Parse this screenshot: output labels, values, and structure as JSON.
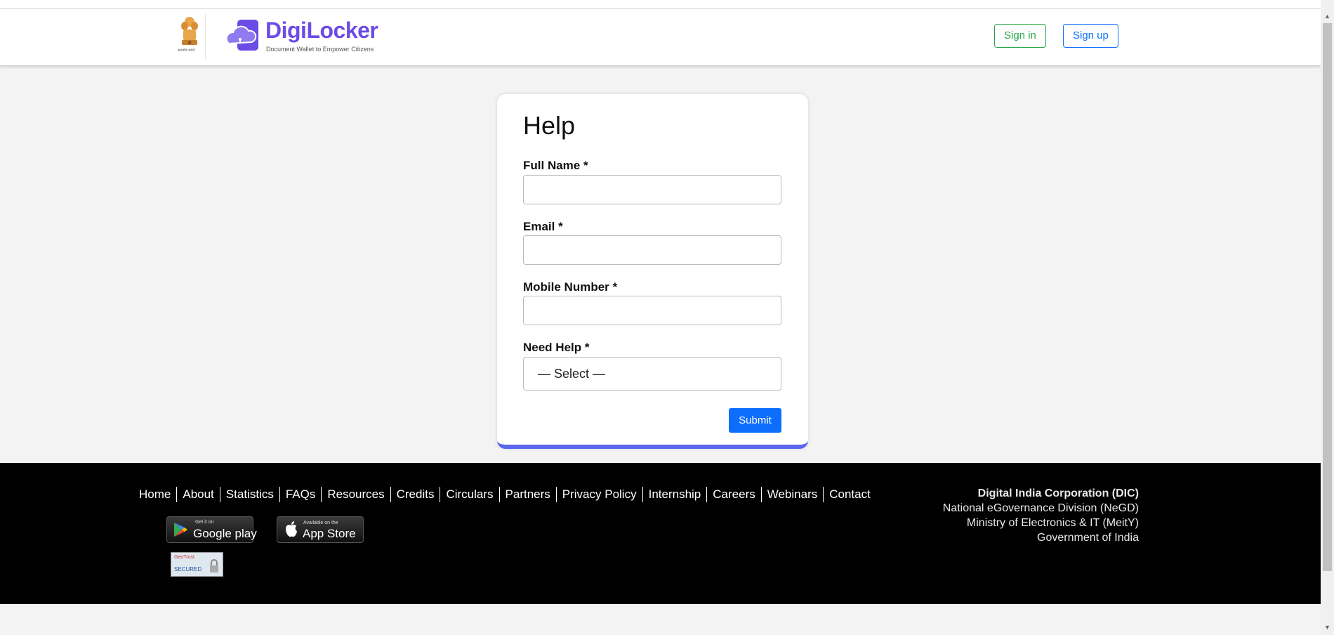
{
  "header": {
    "brand_name": "DigiLocker",
    "brand_tagline": "Document Wallet to Empower Citizens",
    "emblem_text": "सत्यमेव जयते",
    "signin_label": "Sign in",
    "signup_label": "Sign up"
  },
  "form": {
    "title": "Help",
    "fields": [
      {
        "label": "Full Name *",
        "value": ""
      },
      {
        "label": "Email *",
        "value": ""
      },
      {
        "label": "Mobile Number *",
        "value": ""
      }
    ],
    "need_help": {
      "label": "Need Help *",
      "selected": "— Select —"
    },
    "submit_label": "Submit"
  },
  "footer": {
    "nav": [
      "Home",
      "About",
      "Statistics",
      "FAQs",
      "Resources",
      "Credits",
      "Circulars",
      "Partners",
      "Privacy Policy",
      "Internship",
      "Careers",
      "Webinars",
      "Contact"
    ],
    "google_play": {
      "small": "Get it on",
      "big": "Google play"
    },
    "app_store": {
      "small": "Available on the",
      "big": "App Store"
    },
    "geotrust": {
      "brand": "GeoTrust",
      "status": "SECURED"
    },
    "org": {
      "name": "Digital India Corporation (DIC)",
      "lines": [
        "National eGovernance Division (NeGD)",
        "Ministry of Electronics & IT (MeitY)",
        "Government of India"
      ]
    }
  },
  "colors": {
    "brand": "#6c4ce6",
    "signin": "#28a745",
    "primary": "#0d6efd",
    "card_accent": "#5b66ee"
  }
}
